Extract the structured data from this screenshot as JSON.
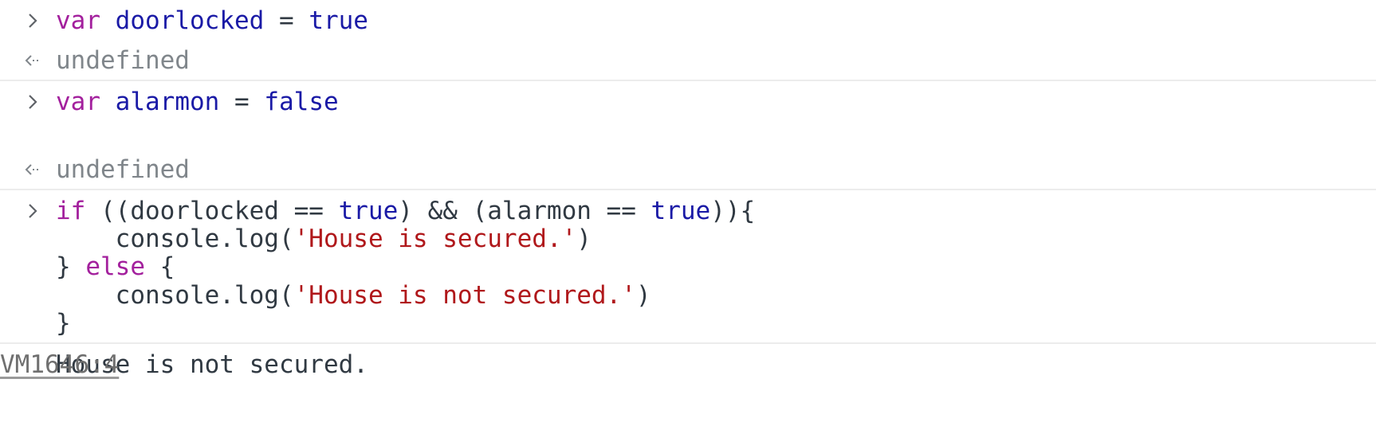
{
  "console": {
    "entries": [
      {
        "input": {
          "kw": "var",
          "name": "doorlocked",
          "op": " = ",
          "value": "true"
        },
        "result": "undefined"
      },
      {
        "input": {
          "kw": "var",
          "name": "alarmon",
          "op": " = ",
          "value": "false"
        },
        "result": "undefined"
      },
      {
        "code": {
          "l1_kw": "if",
          "l1_a": " ((doorlocked == ",
          "l1_true1": "true",
          "l1_b": ") && (alarmon == ",
          "l1_true2": "true",
          "l1_c": ")){",
          "l2_a": "    console.log(",
          "l2_str": "'House is secured.'",
          "l2_b": ")",
          "l3_a": "} ",
          "l3_kw": "else",
          "l3_b": " {",
          "l4_a": "    console.log(",
          "l4_str": "'House is not secured.'",
          "l4_b": ")",
          "l5": "}"
        },
        "log": {
          "text": "House is not secured.",
          "source": "VM1646:4"
        }
      }
    ]
  },
  "icons": {
    "input_prompt": "chevron-right-icon",
    "result_prompt": "return-arrow-icon"
  },
  "colors": {
    "keyword": "#a3209d",
    "identifier": "#1a1aa6",
    "string": "#b0181b",
    "result": "#80868b",
    "text": "#303942"
  }
}
